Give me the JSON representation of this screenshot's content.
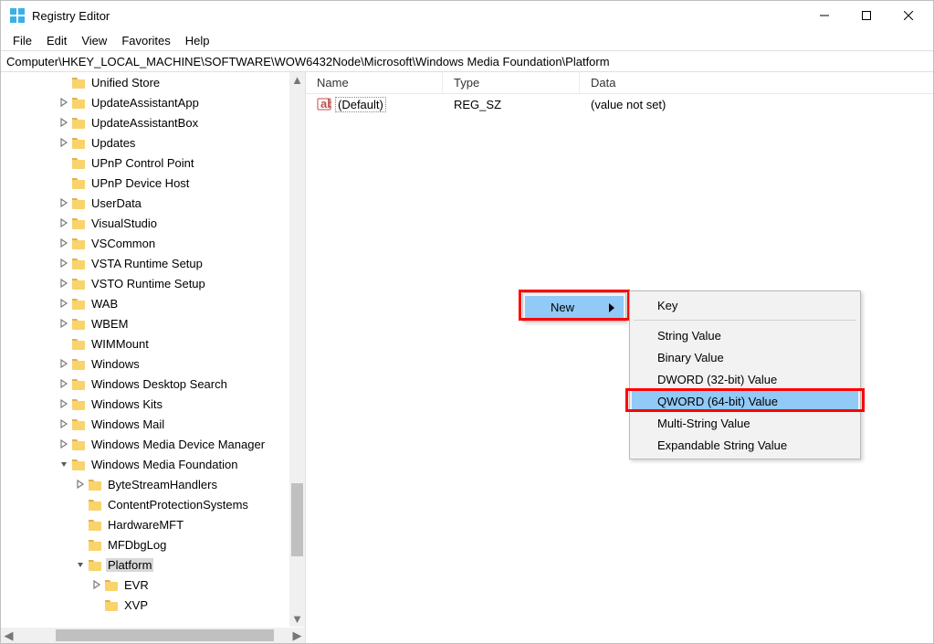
{
  "title": "Registry Editor",
  "menubar": {
    "file": "File",
    "edit": "Edit",
    "view": "View",
    "favorites": "Favorites",
    "help": "Help"
  },
  "address": "Computer\\HKEY_LOCAL_MACHINE\\SOFTWARE\\WOW6432Node\\Microsoft\\Windows Media Foundation\\Platform",
  "tree": [
    {
      "d": 3,
      "e": "none",
      "label": "Unified Store"
    },
    {
      "d": 3,
      "e": "closed",
      "label": "UpdateAssistantApp"
    },
    {
      "d": 3,
      "e": "closed",
      "label": "UpdateAssistantBox"
    },
    {
      "d": 3,
      "e": "closed",
      "label": "Updates"
    },
    {
      "d": 3,
      "e": "none",
      "label": "UPnP Control Point"
    },
    {
      "d": 3,
      "e": "none",
      "label": "UPnP Device Host"
    },
    {
      "d": 3,
      "e": "closed",
      "label": "UserData"
    },
    {
      "d": 3,
      "e": "closed",
      "label": "VisualStudio"
    },
    {
      "d": 3,
      "e": "closed",
      "label": "VSCommon"
    },
    {
      "d": 3,
      "e": "closed",
      "label": "VSTA Runtime Setup"
    },
    {
      "d": 3,
      "e": "closed",
      "label": "VSTO Runtime Setup"
    },
    {
      "d": 3,
      "e": "closed",
      "label": "WAB"
    },
    {
      "d": 3,
      "e": "closed",
      "label": "WBEM"
    },
    {
      "d": 3,
      "e": "none",
      "label": "WIMMount"
    },
    {
      "d": 3,
      "e": "closed",
      "label": "Windows"
    },
    {
      "d": 3,
      "e": "closed",
      "label": "Windows Desktop Search"
    },
    {
      "d": 3,
      "e": "closed",
      "label": "Windows Kits"
    },
    {
      "d": 3,
      "e": "closed",
      "label": "Windows Mail"
    },
    {
      "d": 3,
      "e": "closed",
      "label": "Windows Media Device Manager"
    },
    {
      "d": 3,
      "e": "open",
      "label": "Windows Media Foundation"
    },
    {
      "d": 4,
      "e": "closed",
      "label": "ByteStreamHandlers"
    },
    {
      "d": 4,
      "e": "none",
      "label": "ContentProtectionSystems"
    },
    {
      "d": 4,
      "e": "none",
      "label": "HardwareMFT"
    },
    {
      "d": 4,
      "e": "none",
      "label": "MFDbgLog"
    },
    {
      "d": 4,
      "e": "open",
      "label": "Platform",
      "selected": true
    },
    {
      "d": 5,
      "e": "closed",
      "label": "EVR"
    },
    {
      "d": 5,
      "e": "none",
      "label": "XVP"
    }
  ],
  "columns": {
    "name": "Name",
    "type": "Type",
    "data": "Data"
  },
  "row0": {
    "name": "(Default)",
    "type": "REG_SZ",
    "data": "(value not set)"
  },
  "ctx1": {
    "new": "New"
  },
  "ctx2": {
    "key": "Key",
    "string": "String Value",
    "binary": "Binary Value",
    "dword": "DWORD (32-bit) Value",
    "qword": "QWORD (64-bit) Value",
    "multistring": "Multi-String Value",
    "expandable": "Expandable String Value"
  },
  "colwidths": {
    "name": 150,
    "type": 150
  }
}
